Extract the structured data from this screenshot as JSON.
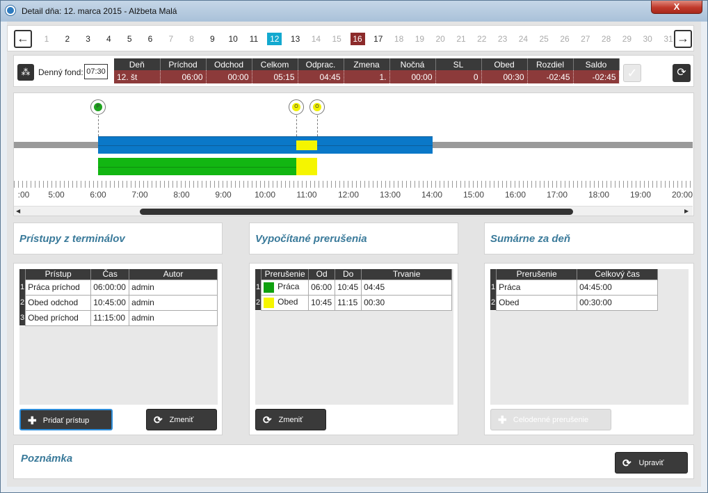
{
  "window": {
    "title": "Detail dňa: 12. marca 2015 -  Alžbeta Malá",
    "close_label": "X"
  },
  "days": {
    "prev_icon": "arrow-left-icon",
    "next_icon": "arrow-right-icon",
    "items": [
      {
        "label": "1",
        "state": "dim"
      },
      {
        "label": "2",
        "state": "normal"
      },
      {
        "label": "3",
        "state": "normal"
      },
      {
        "label": "4",
        "state": "normal"
      },
      {
        "label": "5",
        "state": "normal"
      },
      {
        "label": "6",
        "state": "normal"
      },
      {
        "label": "7",
        "state": "dim"
      },
      {
        "label": "8",
        "state": "dim"
      },
      {
        "label": "9",
        "state": "normal"
      },
      {
        "label": "10",
        "state": "normal"
      },
      {
        "label": "11",
        "state": "normal"
      },
      {
        "label": "12",
        "state": "selected"
      },
      {
        "label": "13",
        "state": "normal"
      },
      {
        "label": "14",
        "state": "dim"
      },
      {
        "label": "15",
        "state": "dim"
      },
      {
        "label": "16",
        "state": "holiday"
      },
      {
        "label": "17",
        "state": "normal"
      },
      {
        "label": "18",
        "state": "dim"
      },
      {
        "label": "19",
        "state": "dim"
      },
      {
        "label": "20",
        "state": "dim"
      },
      {
        "label": "21",
        "state": "dim"
      },
      {
        "label": "22",
        "state": "dim"
      },
      {
        "label": "23",
        "state": "dim"
      },
      {
        "label": "24",
        "state": "dim"
      },
      {
        "label": "25",
        "state": "dim"
      },
      {
        "label": "26",
        "state": "dim"
      },
      {
        "label": "27",
        "state": "dim"
      },
      {
        "label": "28",
        "state": "dim"
      },
      {
        "label": "29",
        "state": "dim"
      },
      {
        "label": "30",
        "state": "dim"
      },
      {
        "label": "31",
        "state": "dim"
      }
    ]
  },
  "summary": {
    "fund_label": "Denný fond:",
    "fund_value": "07:30",
    "headers": [
      "Deň",
      "Príchod",
      "Odchod",
      "Celkom",
      "Odprac.",
      "Zmena",
      "Nočná",
      "SL",
      "Obed",
      "Rozdiel",
      "Saldo"
    ],
    "values": [
      "12. št",
      "06:00",
      "00:00",
      "05:15",
      "04:45",
      "1.",
      "00:00",
      "0",
      "00:30",
      "-02:45",
      "-02:45"
    ],
    "check_icon": "checkmark-icon",
    "refresh_icon": "refresh-icon"
  },
  "timeline": {
    "ticks": [
      ":00",
      "5:00",
      "6:00",
      "7:00",
      "8:00",
      "9:00",
      "10:00",
      "11:00",
      "12:00",
      "13:00",
      "14:00",
      "15:00",
      "16:00",
      "17:00",
      "18:00",
      "19:00",
      "20:00"
    ],
    "pins": [
      {
        "label": "P",
        "color": "#1fa31f"
      },
      {
        "label": "O",
        "color": "#f1f100"
      },
      {
        "label": "O",
        "color": "#f1f100"
      }
    ],
    "colors": {
      "work": "#0a78c8",
      "work_actual": "#12b612",
      "break": "#f5f500",
      "axis": "#9a9a9a"
    }
  },
  "access": {
    "title": "Prístupy z terminálov",
    "headers": [
      "Prístup",
      "Čas",
      "Autor"
    ],
    "rows": [
      {
        "n": "1",
        "type": "Práca príchod",
        "time": "06:00:00",
        "author": "admin"
      },
      {
        "n": "2",
        "type": "Obed odchod",
        "time": "10:45:00",
        "author": "admin"
      },
      {
        "n": "3",
        "type": "Obed príchod",
        "time": "11:15:00",
        "author": "admin"
      }
    ],
    "add_label": "Pridať prístup",
    "change_label": "Zmeniť"
  },
  "breaks": {
    "title": "Vypočítané prerušenia",
    "headers": [
      "Prerušenie",
      "Od",
      "Do",
      "Trvanie"
    ],
    "rows": [
      {
        "n": "1",
        "name": "Práca",
        "from": "06:00",
        "to": "10:45",
        "dur": "04:45",
        "color": "#0fa00f"
      },
      {
        "n": "2",
        "name": "Obed",
        "from": "10:45",
        "to": "11:15",
        "dur": "00:30",
        "color": "#f5f500"
      }
    ],
    "change_label": "Zmeniť"
  },
  "daily": {
    "title": "Sumárne za deň",
    "headers": [
      "Prerušenie",
      "Celkový čas"
    ],
    "rows": [
      {
        "n": "1",
        "name": "Práca",
        "total": "04:45:00"
      },
      {
        "n": "2",
        "name": "Obed",
        "total": "00:30:00"
      }
    ],
    "fullday_label": "Celodenné prerušenie"
  },
  "note": {
    "title": "Poznámka",
    "edit_label": "Upraviť"
  }
}
